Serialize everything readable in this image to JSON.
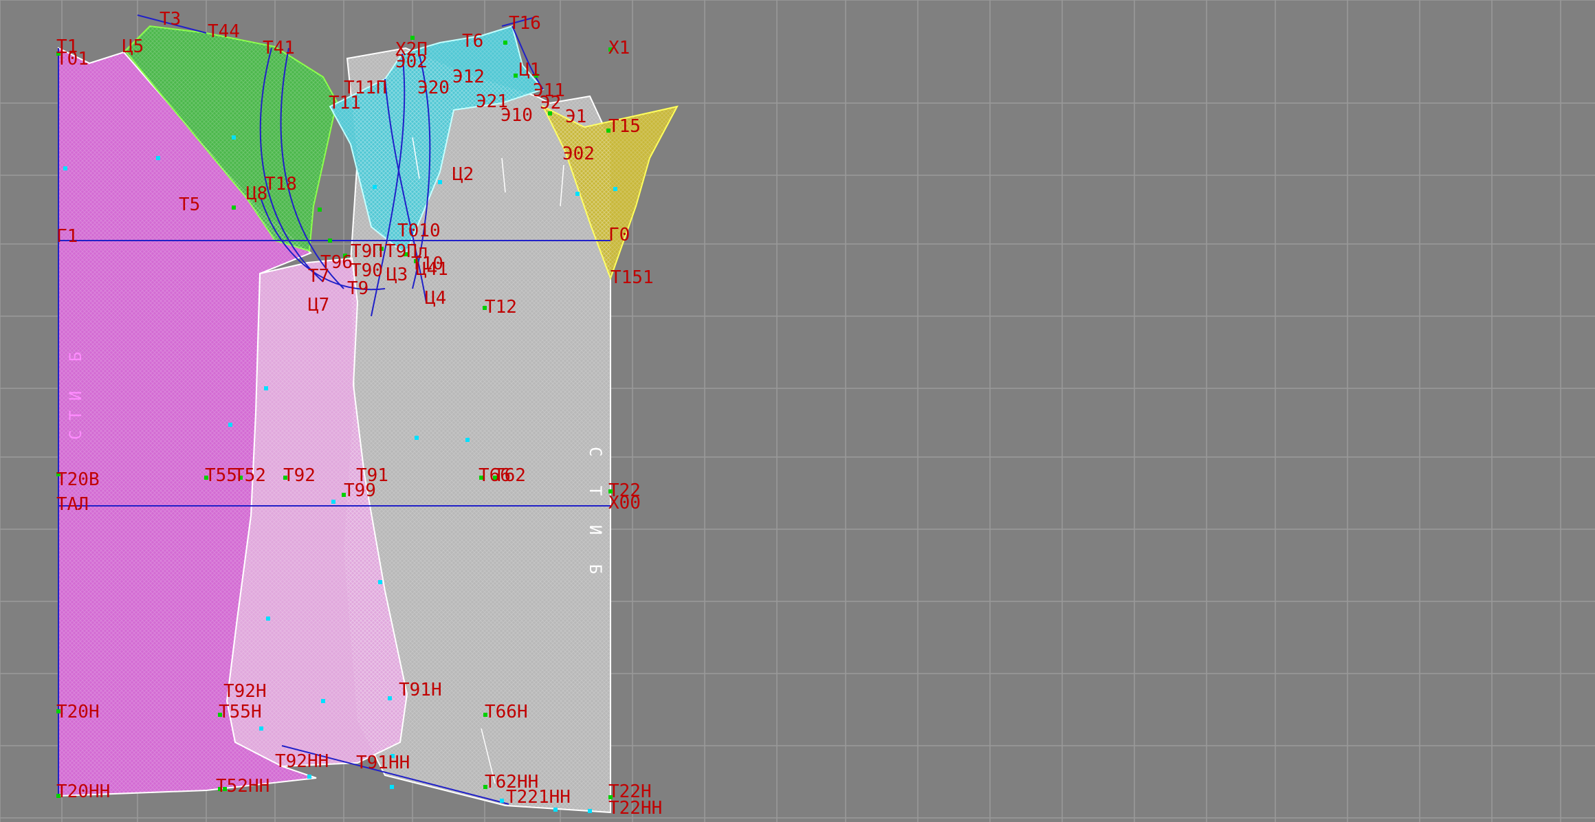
{
  "colors": {
    "background": "#808080",
    "grid": "#9a9a9a",
    "label": "#c00000",
    "axis_line": "#2020c8",
    "front_piece": "#d36bd3",
    "back_piece": "#b8b8b8",
    "side_piece": "#e0a8dc",
    "collar_left": "#4cb84c",
    "collar_mid": "#52c8d4",
    "collar_right": "#c8b83a",
    "point_green": "#00d000",
    "point_cyan": "#00e0ff"
  },
  "labels": [
    {
      "id": "t1",
      "text": "Т1"
    },
    {
      "id": "t01",
      "text": "Т01"
    },
    {
      "id": "ts5",
      "text": "Ц5"
    },
    {
      "id": "t3",
      "text": "Т3"
    },
    {
      "id": "t44",
      "text": "Т44"
    },
    {
      "id": "t41",
      "text": "Т41"
    },
    {
      "id": "kh2p",
      "text": "Х2П"
    },
    {
      "id": "e02",
      "text": "Э02"
    },
    {
      "id": "t6",
      "text": "Т6"
    },
    {
      "id": "t16",
      "text": "Т16"
    },
    {
      "id": "kh1",
      "text": "Х1"
    },
    {
      "id": "t11p",
      "text": "Т11П"
    },
    {
      "id": "t11",
      "text": "Т11"
    },
    {
      "id": "e20",
      "text": "Э20"
    },
    {
      "id": "e12",
      "text": "Э12"
    },
    {
      "id": "ts1",
      "text": "Ц1"
    },
    {
      "id": "e11",
      "text": "Э11"
    },
    {
      "id": "e21",
      "text": "Э21"
    },
    {
      "id": "e2",
      "text": "Э2"
    },
    {
      "id": "e10",
      "text": "Э10"
    },
    {
      "id": "e1",
      "text": "Э1"
    },
    {
      "id": "t15",
      "text": "Т15"
    },
    {
      "id": "e02b",
      "text": "Э02"
    },
    {
      "id": "ts2",
      "text": "Ц2"
    },
    {
      "id": "t5",
      "text": "Т5"
    },
    {
      "id": "ts8",
      "text": "Ц8"
    },
    {
      "id": "t18",
      "text": "Т18"
    },
    {
      "id": "g1",
      "text": "Г1"
    },
    {
      "id": "g0",
      "text": "Г0"
    },
    {
      "id": "t010",
      "text": "Т010"
    },
    {
      "id": "t9p",
      "text": "Т9П"
    },
    {
      "id": "t9pl",
      "text": "Т9Пл"
    },
    {
      "id": "t96",
      "text": "Т96"
    },
    {
      "id": "t90",
      "text": "Т90"
    },
    {
      "id": "ts3",
      "text": "Ц3"
    },
    {
      "id": "ts41",
      "text": "Ц41"
    },
    {
      "id": "t10",
      "text": "Т10"
    },
    {
      "id": "t7",
      "text": "Т7"
    },
    {
      "id": "t9",
      "text": "Т9"
    },
    {
      "id": "t151",
      "text": "Т151"
    },
    {
      "id": "ts7",
      "text": "Ц7"
    },
    {
      "id": "ts4",
      "text": "Ц4"
    },
    {
      "id": "t12",
      "text": "Т12"
    },
    {
      "id": "t20v",
      "text": "Т20В"
    },
    {
      "id": "t55",
      "text": "Т55"
    },
    {
      "id": "t52",
      "text": "Т52"
    },
    {
      "id": "t92",
      "text": "Т92"
    },
    {
      "id": "t91",
      "text": "Т91"
    },
    {
      "id": "t66",
      "text": "Т66"
    },
    {
      "id": "t62",
      "text": "Т62"
    },
    {
      "id": "t22",
      "text": "Т22"
    },
    {
      "id": "tal",
      "text": "ТАЛ"
    },
    {
      "id": "t99",
      "text": "Т99"
    },
    {
      "id": "kh00",
      "text": "Х00"
    },
    {
      "id": "t92n",
      "text": "Т92Н"
    },
    {
      "id": "t91n",
      "text": "Т91Н"
    },
    {
      "id": "t20n",
      "text": "Т20Н"
    },
    {
      "id": "t55n",
      "text": "Т55Н"
    },
    {
      "id": "t66n",
      "text": "Т66Н"
    },
    {
      "id": "t92nn",
      "text": "Т92НН"
    },
    {
      "id": "t91nn",
      "text": "Т91НН"
    },
    {
      "id": "t20nn",
      "text": "Т20НН"
    },
    {
      "id": "t52nn",
      "text": "Т52НН"
    },
    {
      "id": "t62nn",
      "text": "Т62НН"
    },
    {
      "id": "t221nn",
      "text": "Т221НН"
    },
    {
      "id": "t22n",
      "text": "Т22Н"
    },
    {
      "id": "t22nn",
      "text": "Т22НН"
    }
  ],
  "vertical_texts": {
    "front_grain": "СТИ Б",
    "back_grain": "С Т И Б"
  }
}
